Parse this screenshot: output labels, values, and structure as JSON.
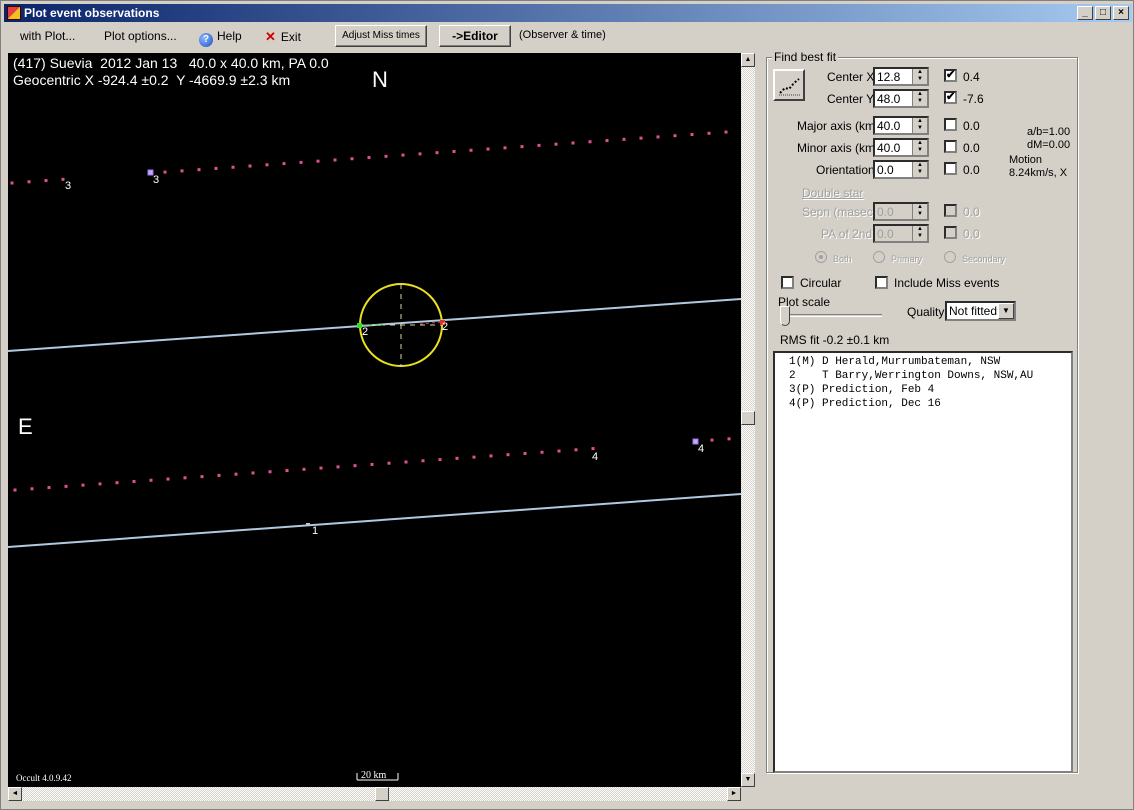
{
  "window": {
    "title": "Plot event observations",
    "controls": {
      "minimize": "_",
      "maximize": "□",
      "close": "×"
    }
  },
  "menubar": {
    "with_plot": "with Plot...",
    "plot_options": "Plot options...",
    "help": "Help",
    "exit": "Exit",
    "adjust_miss": "Adjust Miss times",
    "editor": "->Editor",
    "observer_time": "(Observer & time)"
  },
  "plot": {
    "header_line1": "(417) Suevia  2012 Jan 13   40.0 x 40.0 km, PA 0.0",
    "header_line2": "Geocentric X -924.4 ±0.2  Y -4669.9 ±2.3 km",
    "north_label": "N",
    "east_label": "E",
    "version": "Occult 4.0.9.42",
    "scale_bar": "20 km",
    "chord_labels": {
      "c1": "1",
      "c2a": "2",
      "c2b": "2",
      "c3a": "3",
      "c3b": "3",
      "c4a": "4",
      "c4b": "4"
    },
    "colors": {
      "chord": "#b0c8e0",
      "prediction_dots": "#e0509a",
      "ellipse": "#e8e020",
      "disappear": "#30e030",
      "reappear": "#e03030"
    }
  },
  "fit": {
    "group_title": "Find best fit",
    "center_x": {
      "label": "Center X",
      "value": "12.8",
      "checked": true,
      "result": "0.4"
    },
    "center_y": {
      "label": "Center Y",
      "value": "48.0",
      "checked": true,
      "result": "-7.6"
    },
    "major_axis": {
      "label": "Major axis (km)",
      "value": "40.0",
      "checked": false,
      "result": "0.0"
    },
    "minor_axis": {
      "label": "Minor axis (km)",
      "value": "40.0",
      "checked": false,
      "result": "0.0"
    },
    "orientation": {
      "label": "Orientation",
      "value": "0.0",
      "checked": false,
      "result": "0.0"
    },
    "ab_ratio": "a/b=1.00",
    "dm": "dM=0.00",
    "motion_label": "Motion",
    "motion_value": "8.24km/s, X",
    "double_star": "Double star",
    "sepn": {
      "label": "Sepn (masec)",
      "value": "0.0",
      "result": "0.0"
    },
    "pa2nd": {
      "label": "PA of 2nd",
      "value": "0.0",
      "result": "0.0"
    },
    "radio_both": "Both",
    "radio_primary": "Primary",
    "radio_secondary": "Secondary",
    "circular": "Circular",
    "include_miss": "Include Miss events",
    "plot_scale": "Plot scale",
    "quality_label": "Quality",
    "quality_value": "Not fitted",
    "rms_fit": "RMS fit -0.2 ±0.1 km"
  },
  "observers": [
    "1(M) D Herald,Murrumbateman, NSW",
    "2    T Barry,Werrington Downs, NSW,AU",
    "3(P) Prediction, Feb 4",
    "4(P) Prediction, Dec 16"
  ]
}
